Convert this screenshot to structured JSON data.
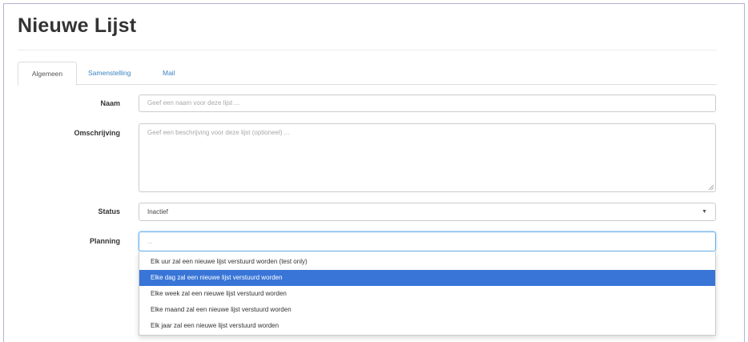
{
  "page": {
    "title": "Nieuwe Lijst"
  },
  "tabs": [
    {
      "label": "Algemeen",
      "active": true
    },
    {
      "label": "Samenstelling",
      "active": false
    },
    {
      "label": "Mail",
      "active": false
    }
  ],
  "form": {
    "naam": {
      "label": "Naam",
      "placeholder": "Geef een naam voor deze lijst ..."
    },
    "omschrijving": {
      "label": "Omschrijving",
      "placeholder": "Geef een beschrijving voor deze lijst (optioneel) ..."
    },
    "status": {
      "label": "Status",
      "value": "Inactief"
    },
    "planning": {
      "label": "Planning",
      "search_value": "...",
      "options": [
        "Elk uur zal een nieuwe lijst verstuurd worden (test only)",
        "Elke dag zal een nieuwe lijst verstuurd worden",
        "Elke week zal een nieuwe lijst verstuurd worden",
        "Elke maand zal een nieuwe lijst verstuurd worden",
        "Elk jaar zal een nieuwe lijst verstuurd worden"
      ],
      "highlighted_index": 1
    }
  },
  "colors": {
    "link": "#3b83c0",
    "highlight": "#3875d7",
    "focus_border": "#66afe9"
  }
}
